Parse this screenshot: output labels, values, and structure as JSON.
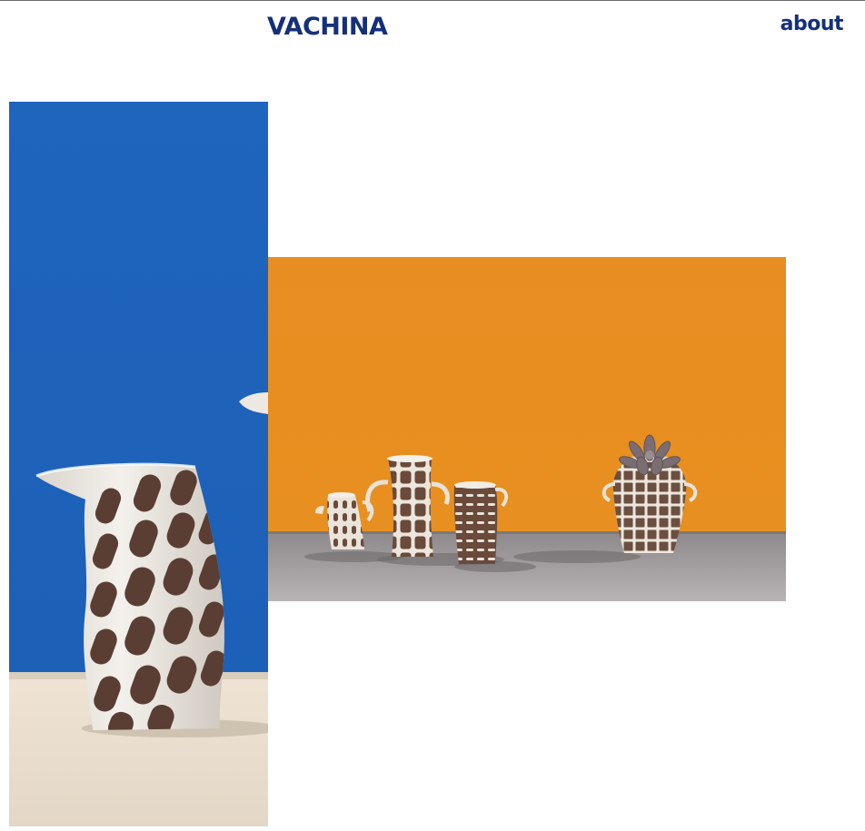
{
  "header": {
    "brand": "VACHINA",
    "nav_about": "about"
  },
  "gallery": {
    "images": [
      {
        "name": "blue-backdrop-vase-photo",
        "backdrop": "#1f64bd",
        "surface": "#e6dccd"
      },
      {
        "name": "orange-backdrop-pottery-group-photo",
        "backdrop": "#e88d22",
        "surface": "#8f8a8c"
      }
    ]
  },
  "colors": {
    "brand": "#15307a",
    "top_rule": "#6c6c6c"
  }
}
